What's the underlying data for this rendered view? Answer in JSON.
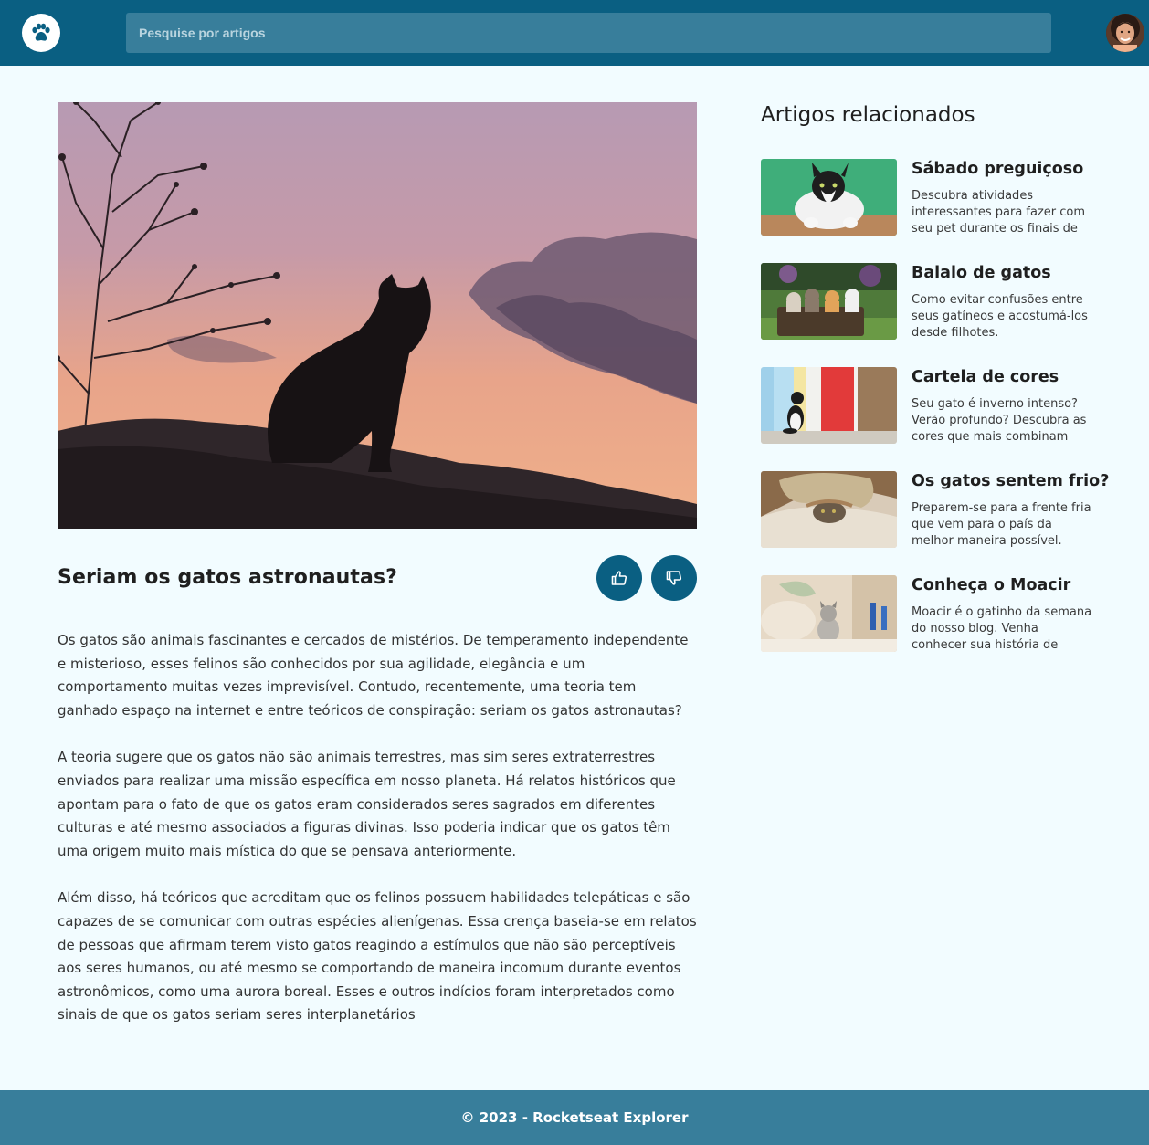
{
  "header": {
    "logo_icon": "paw-icon",
    "search_placeholder": "Pesquise por artigos",
    "avatar_icon": "user-avatar"
  },
  "article": {
    "image_icon": "cat-silhouette-sunset-image",
    "title": "Seriam os gatos astronautas?",
    "like_icon": "thumbs-up-icon",
    "dislike_icon": "thumbs-down-icon",
    "paragraphs": [
      "Os gatos são animais fascinantes e cercados de mistérios. De temperamento independente e misterioso, esses felinos são conhecidos por sua agilidade, elegância e um comportamento muitas vezes imprevisível. Contudo, recentemente, uma teoria tem ganhado espaço na internet e entre teóricos de conspiração: seriam os gatos astronautas?",
      "A teoria sugere que os gatos não são animais terrestres, mas sim seres extraterrestres enviados para realizar uma missão específica em nosso planeta. Há relatos históricos que apontam para o fato de que os gatos eram considerados seres sagrados em diferentes culturas e até mesmo associados a figuras divinas. Isso poderia indicar que os gatos têm uma origem muito mais mística do que se pensava anteriormente.",
      "Além disso, há teóricos que acreditam que os felinos possuem habilidades telepáticas e são capazes de se comunicar com outras espécies alienígenas. Essa crença baseia-se em relatos de pessoas que afirmam terem visto gatos reagindo a estímulos que não são perceptíveis aos seres humanos, ou até mesmo se comportando de maneira incomum durante eventos astronômicos, como uma aurora boreal. Esses e outros indícios foram interpretados como sinais de que os gatos seriam seres interplanetários"
    ]
  },
  "sidebar": {
    "heading": "Artigos relacionados",
    "items": [
      {
        "title": "Sábado preguiçoso",
        "description": "Descubra atividades interessantes para fazer com seu pet durante os finais de"
      },
      {
        "title": "Balaio de gatos",
        "description": "Como evitar confusões entre seus gatíneos e acostumá-los desde filhotes."
      },
      {
        "title": "Cartela de cores",
        "description": "Seu gato é inverno intenso? Verão profundo? Descubra as cores que mais combinam"
      },
      {
        "title": "Os gatos sentem frio?",
        "description": "Preparem-se para a frente fria que vem para o país da melhor maneira possível."
      },
      {
        "title": "Conheça o Moacir",
        "description": "Moacir é o gatinho da semana do nosso blog. Venha conhecer sua história de"
      }
    ]
  },
  "footer": {
    "text": "© 2023 - Rocketseat Explorer"
  },
  "colors": {
    "header_bg": "#0a5f82",
    "search_bg": "#387e9b",
    "page_bg": "#f2fcff",
    "footer_bg": "#387e9b",
    "button_bg": "#0a5f82"
  }
}
